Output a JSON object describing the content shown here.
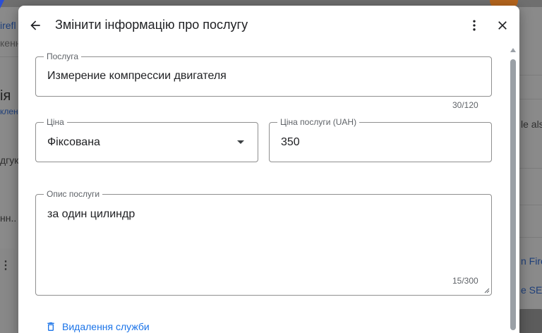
{
  "background": {
    "tab_fragment": "irefl",
    "subtitle_fragment": "кенн",
    "heading_fragment": "ія",
    "link_fragment": "клен",
    "text_fragment_1": "дгук",
    "text_fragment_2": "нн..",
    "right_fragment_1": "le als",
    "right_fragment_2": "n Fire",
    "right_fragment_3": "e SEC"
  },
  "dialog": {
    "title": "Змінити інформацію про послугу",
    "icons": {
      "back": "arrow-back-icon",
      "more": "more-vert-icon",
      "close": "close-icon"
    }
  },
  "form": {
    "service": {
      "label": "Послуга",
      "value": "Измерение компрессии двигателя",
      "counter": "30/120"
    },
    "price_type": {
      "label": "Ціна",
      "value": "Фіксована"
    },
    "price": {
      "label": "Ціна послуги (UAH)",
      "value": "350"
    },
    "description": {
      "label": "Опис послуги",
      "value": "за один цилиндр",
      "counter": "15/300"
    }
  },
  "actions": {
    "delete_label": "Видалення служби",
    "delete_icon": "trash-icon"
  },
  "colors": {
    "accent": "#1a73e8",
    "text": "#202124",
    "border": "#8f8f8f"
  }
}
